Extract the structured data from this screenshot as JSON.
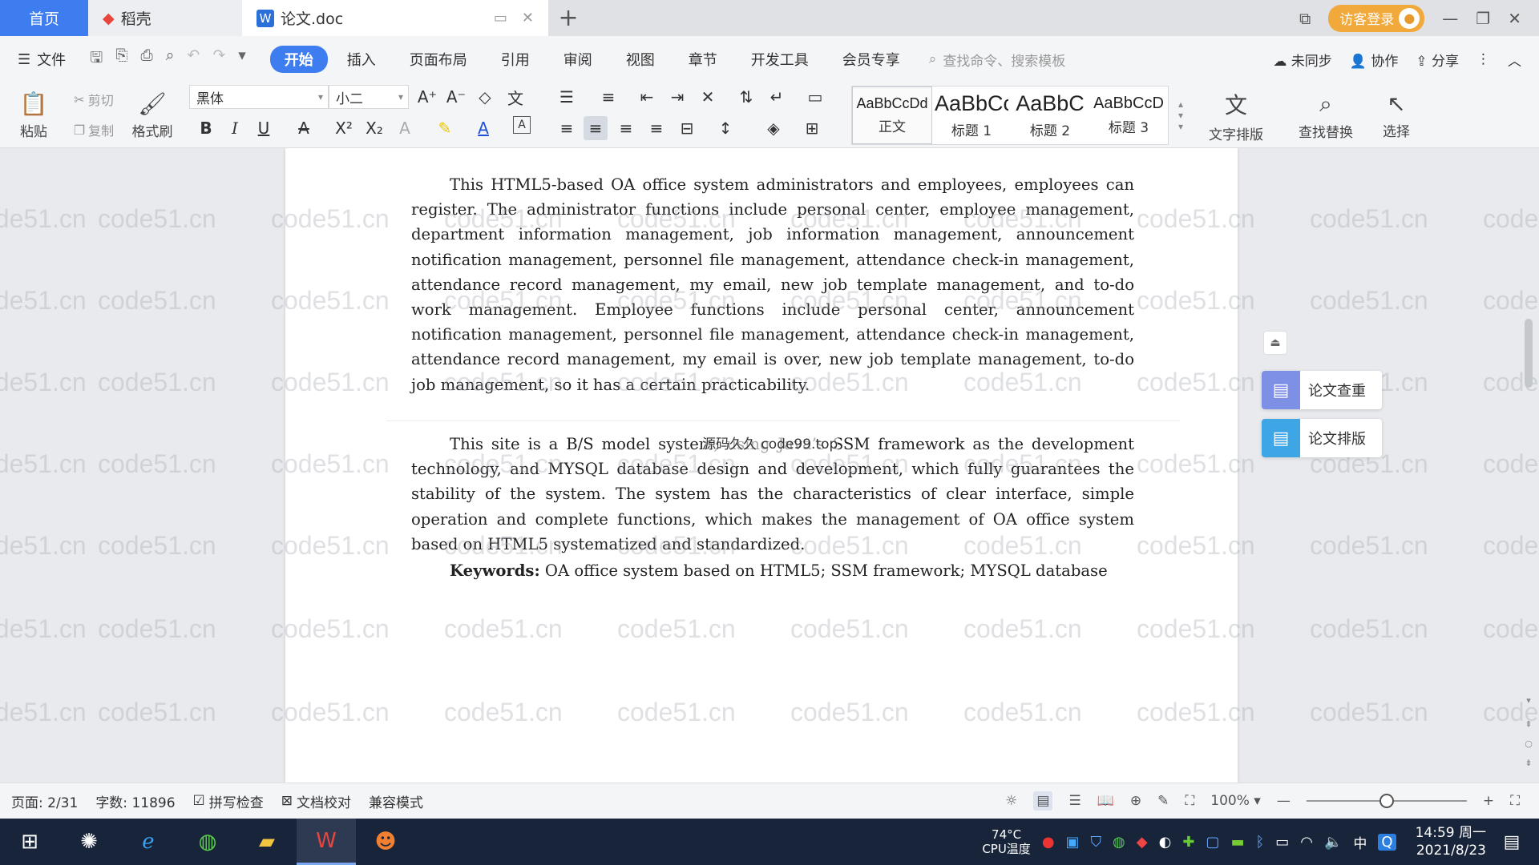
{
  "tabs": {
    "home": "首页",
    "daoke": "稻壳",
    "doc": "论文.doc",
    "new_tab_icon": "plus-icon"
  },
  "titlebar": {
    "login": "访客登录"
  },
  "menubar": {
    "file": "文件",
    "items": [
      "开始",
      "插入",
      "页面布局",
      "引用",
      "审阅",
      "视图",
      "章节",
      "开发工具",
      "会员专享"
    ],
    "search_placeholder": "查找命令、搜索模板",
    "sync": "未同步",
    "collab": "协作",
    "share": "分享"
  },
  "ribbon": {
    "paste": "粘贴",
    "cut": "剪切",
    "copy": "复制",
    "format_painter": "格式刷",
    "font_name": "黑体",
    "font_size": "小二",
    "styles": [
      {
        "preview": "AaBbCcDd",
        "name": "正文"
      },
      {
        "preview": "AaBbCc",
        "name": "标题 1"
      },
      {
        "preview": "AaBbC",
        "name": "标题 2"
      },
      {
        "preview": "AaBbCcD",
        "name": "标题 3"
      }
    ],
    "text_layout": "文字排版",
    "find_replace": "查找替换",
    "select": "选择"
  },
  "document": {
    "para1": "This HTML5-based OA office system administrators and employees, employees can register. The administrator functions include personal center, employee management, department information management, job information management, announcement notification management, personnel file management, attendance check-in management, attendance record management, my email, new job template management, and to-do work management. Employee functions include personal center, announcement notification management, personnel file management, attendance check-in management, attendance record management, my email is over, new job template management, to-do job management, so it has a certain practicability.",
    "para2": "This site is a B/S model system, using Java’s SSM framework as the development technology, and MYSQL database design and development, which fully guarantees the stability of the system. The system has the characteristics of clear interface, simple operation and complete functions, which makes the management of OA office system based on HTML5 systematized and standardized.",
    "keywords_label": "Keywords:",
    "keywords": " OA office system based on HTML5; SSM framework; MYSQL database",
    "overlay": "源码久久 code99.top",
    "watermark": "code51.cn"
  },
  "side_panel": {
    "check": "论文查重",
    "layout": "论文排版"
  },
  "statusbar": {
    "page": "页面: 2/31",
    "words": "字数: 11896",
    "spell": "拼写检查",
    "proof": "文档校对",
    "compat": "兼容模式",
    "zoom": "100%",
    "zoom_level": 0.5
  },
  "taskbar": {
    "cpu_temp": "74°C",
    "cpu_label": "CPU温度",
    "ime": "中",
    "time": "14:59 周一",
    "date": "2021/8/23"
  }
}
